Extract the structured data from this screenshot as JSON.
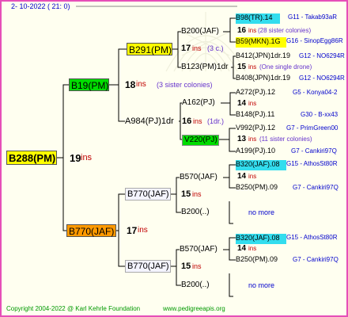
{
  "header": {
    "date": "2- 10-2022 ( 21: 0)"
  },
  "tree": {
    "root": {
      "id": "B288(PM)",
      "gen_num": "19",
      "gen_word": "ins"
    },
    "sire": {
      "id": "B19(PM)",
      "gen_num": "18",
      "gen_word": "ins",
      "note": "(3 sister colonies)"
    },
    "dam": {
      "id": "B770(JAF)",
      "gen_num": "17",
      "gen_word": "ins"
    },
    "g3": [
      {
        "id": "B291(PM)",
        "gen_num": "17",
        "gen_word": "ins",
        "note": "(3 c.)"
      },
      {
        "id": "A984(PJ)1dr",
        "gen_num": "16",
        "gen_word": "ins",
        "note": "(1dr.)"
      },
      {
        "id": "B770(JAF)",
        "gen_num": "15",
        "gen_word": "ins"
      },
      {
        "id": "B770(JAF)",
        "gen_num": "15",
        "gen_word": "ins"
      }
    ],
    "g4": [
      {
        "id": "B200(JAF)"
      },
      {
        "id": "B123(PM)1dr"
      },
      {
        "id": "A162(PJ)"
      },
      {
        "id": "V220(PJ)"
      },
      {
        "id": "B570(JAF)"
      },
      {
        "id": "B200(..)"
      },
      {
        "id": "B570(JAF)"
      },
      {
        "id": "B200(..)"
      }
    ],
    "g5n": [
      {
        "gen_num": "16",
        "gen_word": "ins",
        "note": "(28 sister colonies)"
      },
      {
        "gen_num": "15",
        "gen_word": "ins",
        "note": "(One single drone)"
      },
      {
        "gen_num": "14",
        "gen_word": "ins"
      },
      {
        "gen_num": "13",
        "gen_word": "ins",
        "note": "(11 sister colonies)"
      },
      {
        "gen_num": "14",
        "gen_word": "ins"
      },
      {
        "gen_num": "14",
        "gen_word": "ins"
      }
    ],
    "g5": [
      {
        "id": "B98(TR).14",
        "breeder": "G11 - Takab93aR"
      },
      {
        "id": "B59(MKN).1G",
        "breeder": "G16 - SinopEgg86R"
      },
      {
        "id": "B412(JPN)1dr.19",
        "breeder": "G12 - NO6294R"
      },
      {
        "id": "B408(JPN)1dr.19",
        "breeder": "G12 - NO6294R"
      },
      {
        "id": "A272(PJ).12",
        "breeder": "G5 - Konya04-2"
      },
      {
        "id": "B148(PJ).11",
        "breeder": "G30 - B-xx43"
      },
      {
        "id": "V992(PJ).12",
        "breeder": "G7 - PrimGreen00"
      },
      {
        "id": "A199(PJ).10",
        "breeder": "G7 - Cankiri97Q"
      },
      {
        "id": "B320(JAF).08",
        "breeder": "G15 - AthosSt80R"
      },
      {
        "id": "B250(PM).09",
        "breeder": "G7 - Cankiri97Q"
      },
      {
        "id": "no more"
      },
      {
        "id": "B320(JAF).08",
        "breeder": "G15 - AthosSt80R"
      },
      {
        "id": "B250(PM).09",
        "breeder": "G7 - Cankiri97Q"
      },
      {
        "id": "no more"
      }
    ]
  },
  "footer": {
    "copyright": "Copyright 2004-2022 @ Karl Kehrle Foundation",
    "site": "www.pedigreeapis.org"
  },
  "colors": {
    "frame": "#e64fb8",
    "yellow": "#ffff00",
    "green": "#00dd00",
    "orange": "#ff9900",
    "cyan": "#33ddee",
    "generation_text": "#c00000",
    "link_text": "#0000cc",
    "footer_text": "#009900"
  }
}
